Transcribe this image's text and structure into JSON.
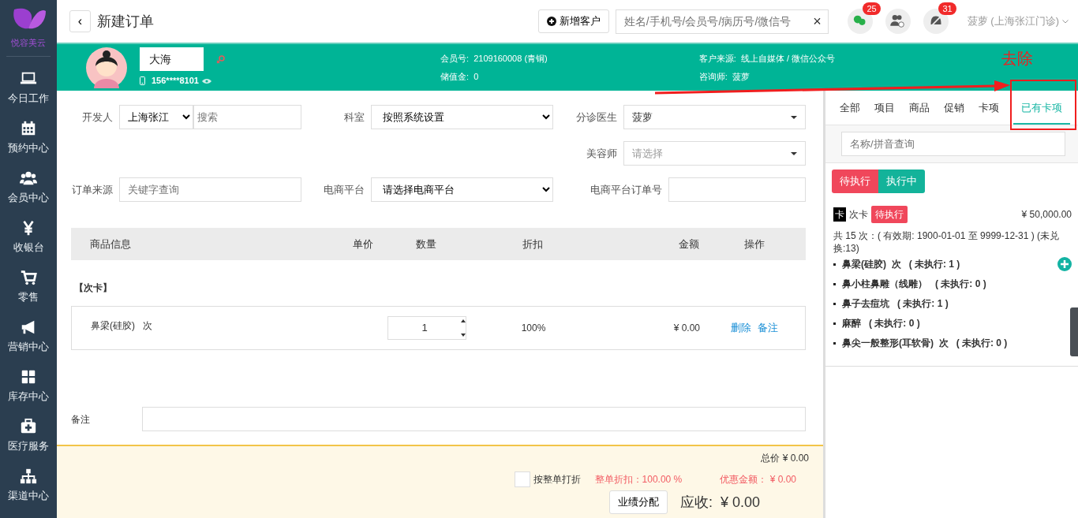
{
  "app": {
    "logo_text": "悦容美云"
  },
  "sidebar": {
    "items": [
      {
        "label": "今日工作"
      },
      {
        "label": "预约中心"
      },
      {
        "label": "会员中心"
      },
      {
        "label": "收银台"
      },
      {
        "label": "零售"
      },
      {
        "label": "营销中心"
      },
      {
        "label": "库存中心"
      },
      {
        "label": "医疗服务"
      },
      {
        "label": "渠道中心"
      }
    ]
  },
  "header": {
    "back": "‹",
    "title": "新建订单",
    "new_customer_button": "新增客户",
    "search": {
      "placeholder": "姓名/手机号/会员号/病历号/微信号",
      "clear": "×"
    },
    "notifications": [
      {
        "badge": true,
        "count": "25"
      },
      {
        "badge": false
      },
      {
        "badge": true,
        "count": "31"
      }
    ],
    "user": "菠萝 (上海张江门诊)"
  },
  "customer": {
    "name": "大海",
    "phone": "156****8101",
    "member_no_label": "会员号:",
    "member_no": "2109160008 (青铜)",
    "balance_label": "储值金:",
    "balance": "0",
    "source_label": "客户来源:",
    "source": "线上自媒体 / 微信公众号",
    "consultant_label": "咨询师:",
    "consultant": "菠萝"
  },
  "form": {
    "rows": [
      {
        "fields": [
          {
            "label": "开发人",
            "kind": "select-search",
            "value": "上海张江",
            "placeholder": "搜索"
          },
          {
            "label": "科室",
            "kind": "select",
            "value": "按照系统设置"
          },
          {
            "label": "分诊医生",
            "kind": "dropdown",
            "value": "菠萝"
          }
        ]
      },
      {
        "fields": [
          {
            "label": "美容师",
            "kind": "dropdown",
            "placeholder": "请选择"
          }
        ]
      },
      {
        "fields": [
          {
            "label": "订单来源",
            "kind": "input",
            "placeholder": "关键字查询"
          },
          {
            "label": "电商平台",
            "kind": "select",
            "value": "请选择电商平台"
          },
          {
            "label": "电商平台订单号",
            "kind": "input"
          }
        ]
      }
    ]
  },
  "table": {
    "columns": [
      "商品信息",
      "单价",
      "数量",
      "折扣",
      "金额",
      "操作"
    ],
    "group": "【次卡】",
    "rows": [
      {
        "name": "鼻梁(硅胶)",
        "unit": "次",
        "quantity": "1",
        "discount": "100%",
        "amount": "¥ 0.00",
        "actions": [
          "删除",
          "备注"
        ]
      }
    ]
  },
  "remark": {
    "label": "备注"
  },
  "summary": {
    "total": "总价 ¥ 0.00",
    "whole_discount": {
      "label": "按整单打折",
      "checked": false
    },
    "discount_rate": "整单折扣：100.00 %",
    "offer": "优惠金额： ¥ 0.00",
    "assign_button": "业绩分配",
    "receivable": "应收:  ¥ 0.00"
  },
  "panel": {
    "tabs": [
      {
        "label": "全部",
        "selected": false
      },
      {
        "label": "项目",
        "selected": false
      },
      {
        "label": "商品",
        "selected": false
      },
      {
        "label": "促销",
        "selected": false
      },
      {
        "label": "卡项",
        "selected": false
      },
      {
        "label": "已有卡项",
        "selected": true
      }
    ],
    "search": {
      "placeholder": "名称/拼音查询"
    },
    "status_buttons": [
      {
        "label": "待执行",
        "color": "#f0475b"
      },
      {
        "label": "执行中",
        "color": "#13b39a"
      }
    ],
    "card": {
      "type_badge": "卡",
      "name": "次卡",
      "status": "待执行",
      "price": "¥ 50,000.00",
      "summary": "共 15 次：( 有效期: 1900-01-01 至 9999-12-31 ) (未兑换:13)",
      "items": [
        {
          "name": "鼻梁(硅胶)  次",
          "remaining": "( 未执行: 1 )",
          "addable": true
        },
        {
          "name": "鼻小柱鼻雕（线雕）",
          "remaining": "( 未执行: 0 )",
          "addable": false
        },
        {
          "name": "鼻子去痘坑",
          "remaining": "( 未执行: 1 )",
          "addable": false
        },
        {
          "name": "麻醉",
          "remaining": "( 未执行: 0 )",
          "addable": false
        },
        {
          "name": "鼻尖一般整形(耳软骨)  次",
          "remaining": "( 未执行: 0 )",
          "addable": false
        }
      ]
    }
  },
  "annotation": {
    "text": "去除"
  }
}
